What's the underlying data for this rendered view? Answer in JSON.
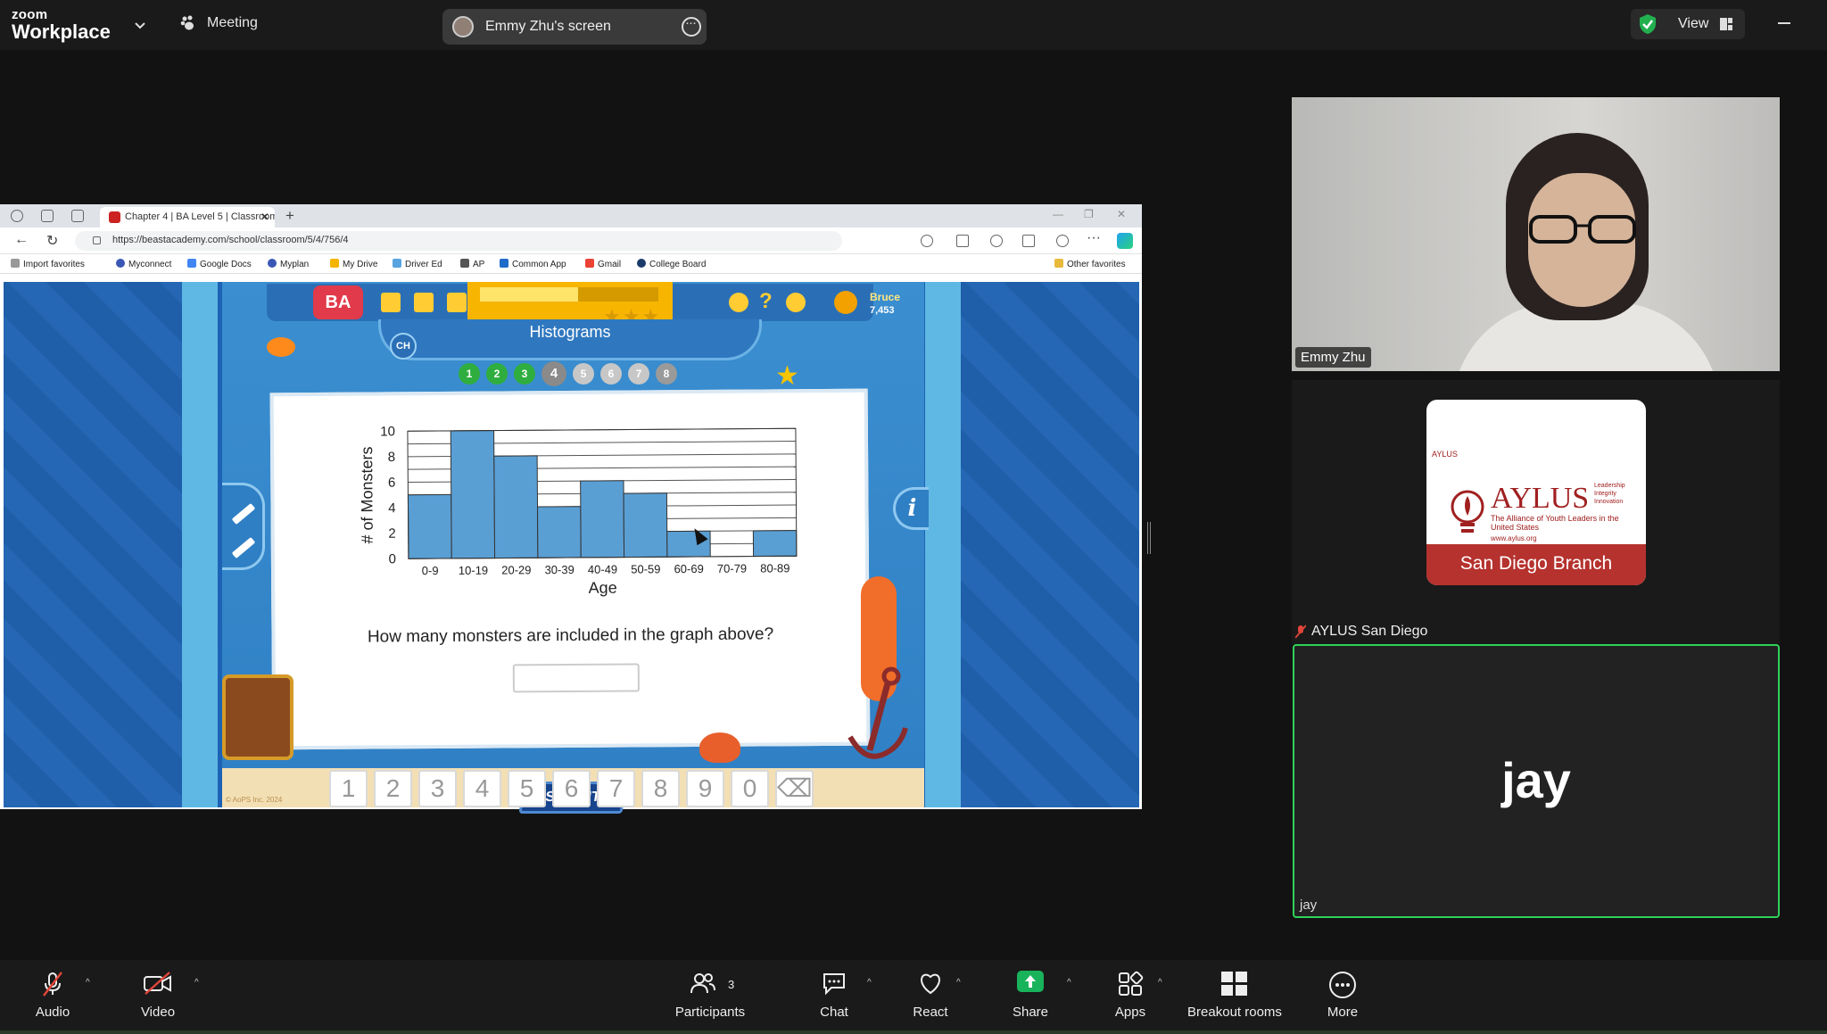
{
  "zoom": {
    "brand_line1": "zoom",
    "brand_line2": "Workplace",
    "meeting_label": "Meeting",
    "screen_share_label": "Emmy Zhu's screen",
    "view_label": "View"
  },
  "browser": {
    "tab_title": "Chapter 4 | BA Level 5 | Classroom",
    "url": "https://beastacademy.com/school/classroom/5/4/756/4",
    "favorites": [
      "Import favorites",
      "Myconnect",
      "Google Docs",
      "Myplan",
      "My Drive",
      "Driver Ed",
      "AP",
      "Common App",
      "Gmail",
      "College Board"
    ],
    "other_favorites": "Other favorites"
  },
  "game": {
    "logo": "BA",
    "ch_button": "CH",
    "title": "Histograms",
    "user_name": "Bruce",
    "user_score": "7,453",
    "progress": 0.55,
    "problem_dots": [
      {
        "label": "1",
        "state": "done"
      },
      {
        "label": "2",
        "state": "done"
      },
      {
        "label": "3",
        "state": "done"
      },
      {
        "label": "4",
        "state": "current"
      },
      {
        "label": "5",
        "state": "todo"
      },
      {
        "label": "6",
        "state": "todo"
      },
      {
        "label": "7",
        "state": "todo"
      },
      {
        "label": "8",
        "state": "locked"
      }
    ],
    "question": "How many monsters are included in the graph above?",
    "submit_label": "SUBMIT",
    "numpad": [
      "1",
      "2",
      "3",
      "4",
      "5",
      "6",
      "7",
      "8",
      "9",
      "0",
      "⌫"
    ],
    "copyright": "© AoPS Inc. 2024"
  },
  "chart_data": {
    "type": "bar",
    "categories": [
      "0-9",
      "10-19",
      "20-29",
      "30-39",
      "40-49",
      "50-59",
      "60-69",
      "70-79",
      "80-89"
    ],
    "values": [
      5,
      10,
      8,
      4,
      6,
      5,
      2,
      0,
      2
    ],
    "xlabel": "Age",
    "ylabel": "# of Monsters",
    "ylim": [
      0,
      10
    ],
    "yticks": [
      0,
      2,
      4,
      6,
      8,
      10
    ],
    "grid": true,
    "bar_color": "#5a9fd4"
  },
  "participants": {
    "emmy_name": "Emmy Zhu",
    "aylus_name": "AYLUS San Diego",
    "aylus_logo_small": "AYLUS",
    "aylus_logo_big": "AYLUS",
    "aylus_tagline": "Leadership Integrity Innovation",
    "aylus_subtitle": "The Alliance of Youth Leaders in the United States",
    "aylus_website": "www.aylus.org",
    "aylus_branch": "San Diego Branch",
    "jay_big": "jay",
    "jay_name": "jay"
  },
  "toolbar": {
    "audio": "Audio",
    "video": "Video",
    "participants": "Participants",
    "participants_count": "3",
    "chat": "Chat",
    "react": "React",
    "share": "Share",
    "apps": "Apps",
    "breakout": "Breakout rooms",
    "more": "More"
  },
  "colors": {
    "zoom_bg": "#1a1a1a",
    "active_speaker": "#2fd35a",
    "share_green": "#19b35b",
    "aylus_red": "#b5322e"
  }
}
